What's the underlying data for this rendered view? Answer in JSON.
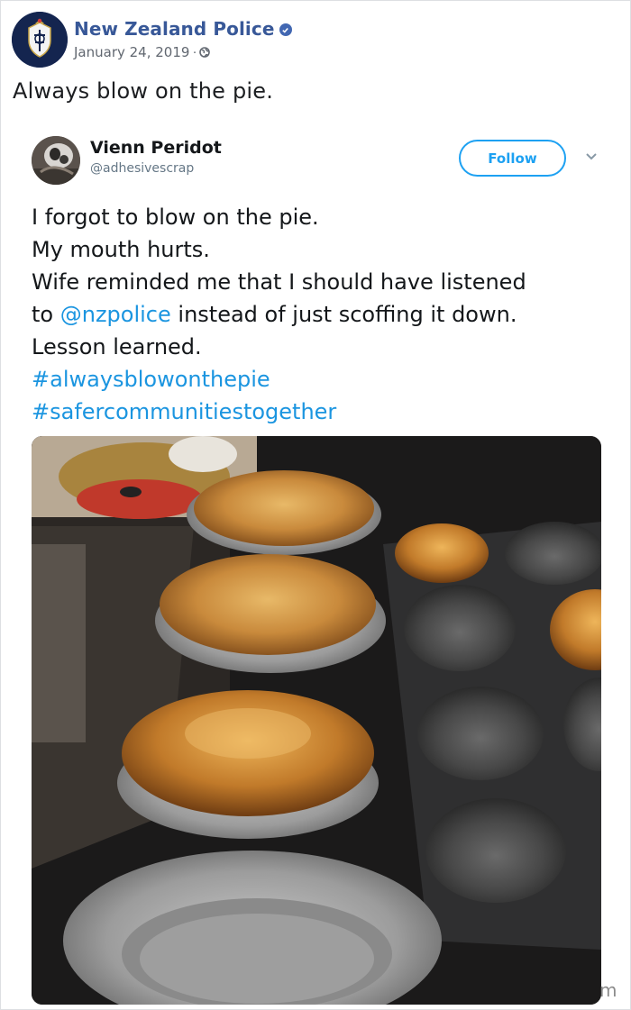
{
  "post": {
    "page_name": "New Zealand Police",
    "date": "January 24, 2019",
    "separator": "·",
    "caption": "Always blow on the pie.",
    "icons": {
      "verified": "verified-badge-icon",
      "audience": "globe-icon",
      "avatar": "police-crest-logo"
    }
  },
  "tweet": {
    "author_name": "Vienn Peridot",
    "author_handle": "@adhesivescrap",
    "follow_label": "Follow",
    "text": {
      "line1": "I forgot to blow on the pie.",
      "line2": "My mouth hurts.",
      "line3": "Wife reminded me that I should have listened",
      "line4_prefix": "to ",
      "line4_mention": "@nzpolice",
      "line4_suffix": " instead of just scoffing it down.",
      "line5": "Lesson learned.",
      "hashtag1": "#alwaysblowonthepie",
      "hashtag2": "#safercommunitiestogether"
    },
    "photo": "pies-on-baking-trays"
  },
  "watermark": "m",
  "colors": {
    "facebook_link": "#385898",
    "verified": "#4267b2",
    "twitter_blue": "#1da1f2",
    "twitter_link": "#1b95e0",
    "muted": "#616770"
  }
}
